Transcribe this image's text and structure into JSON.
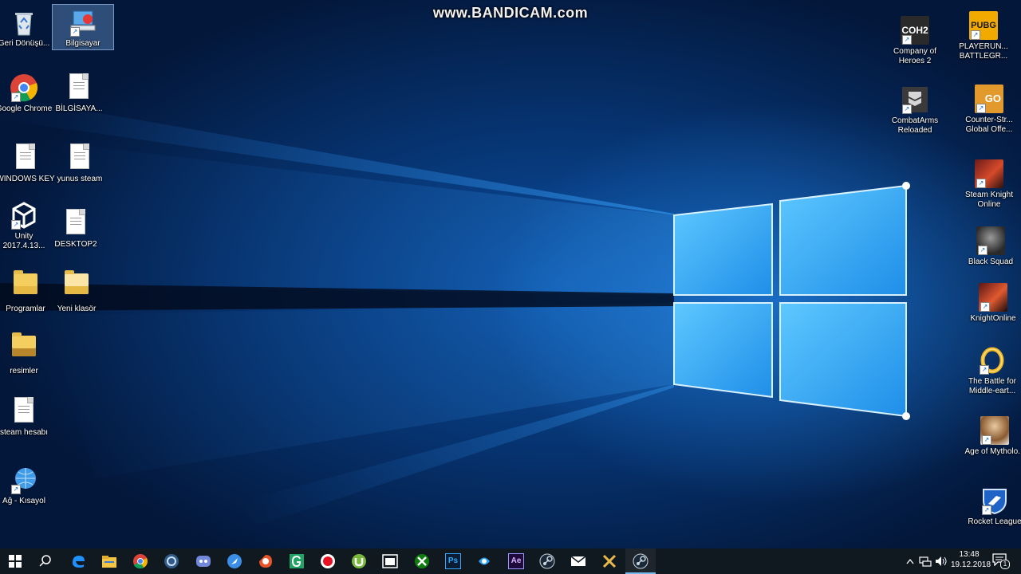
{
  "watermark": "www.BANDICAM.com",
  "desktop_left": [
    {
      "label": "Geri Dönüşü...",
      "icon": "recycle-bin-icon"
    },
    {
      "label": "Bilgisayar",
      "icon": "computer-icon",
      "selected": true
    },
    {
      "label": "Google Chrome",
      "icon": "chrome-icon"
    },
    {
      "label": "BİLGİSAYA...",
      "icon": "text-file-icon"
    },
    {
      "label": "WINDOWS KEY",
      "icon": "text-file-icon"
    },
    {
      "label": "yunus steam",
      "icon": "text-file-icon"
    },
    {
      "label": "Unity 2017.4.13...",
      "icon": "unity-icon"
    },
    {
      "label": "DESKTOP2",
      "icon": "text-file-icon"
    },
    {
      "label": "Programlar",
      "icon": "folder-icon"
    },
    {
      "label": "Yeni klasör",
      "icon": "folder-icon"
    },
    {
      "label": "resimler",
      "icon": "folder-icon"
    },
    {
      "label": "steam hesabı",
      "icon": "text-file-icon"
    },
    {
      "label": "Ağ - Kısayol",
      "icon": "network-icon"
    }
  ],
  "desktop_right": [
    {
      "label": "Company of Heroes 2",
      "icon": "coh2-icon",
      "badge": "COH2"
    },
    {
      "label": "PLAYERUN... BATTLEGR...",
      "icon": "pubg-icon",
      "badge": "PUBG"
    },
    {
      "label": "CombatArms Reloaded",
      "icon": "combat-arms-icon"
    },
    {
      "label": "Counter-Str... Global Offe...",
      "icon": "csgo-icon",
      "badge": "GO"
    },
    {
      "label": "Steam Knight Online",
      "icon": "knight-online-icon"
    },
    {
      "label": "Black Squad",
      "icon": "black-squad-icon"
    },
    {
      "label": "KnightOnline",
      "icon": "knight-online-icon"
    },
    {
      "label": "The Battle for Middle-eart...",
      "icon": "ring-icon"
    },
    {
      "label": "Age of Mytholo...",
      "icon": "age-of-mythology-icon"
    },
    {
      "label": "Rocket League",
      "icon": "rocket-league-icon"
    }
  ],
  "taskbar": {
    "apps": [
      "edge-icon",
      "file-explorer-icon",
      "chrome-icon",
      "app-icon",
      "discord-icon",
      "globe-icon",
      "browser-icon",
      "g-app-icon",
      "bandicam-record-icon",
      "utorrent-icon",
      "window-app-icon",
      "xbox-icon",
      "photoshop-icon",
      "network-app-icon",
      "after-effects-icon",
      "steam-icon",
      "mail-icon",
      "game-icon",
      "steam-icon"
    ],
    "ps_label": "Ps",
    "ae_label": "Ae",
    "time": "13:48",
    "date": "19.12.2018",
    "notification_count": "1"
  }
}
